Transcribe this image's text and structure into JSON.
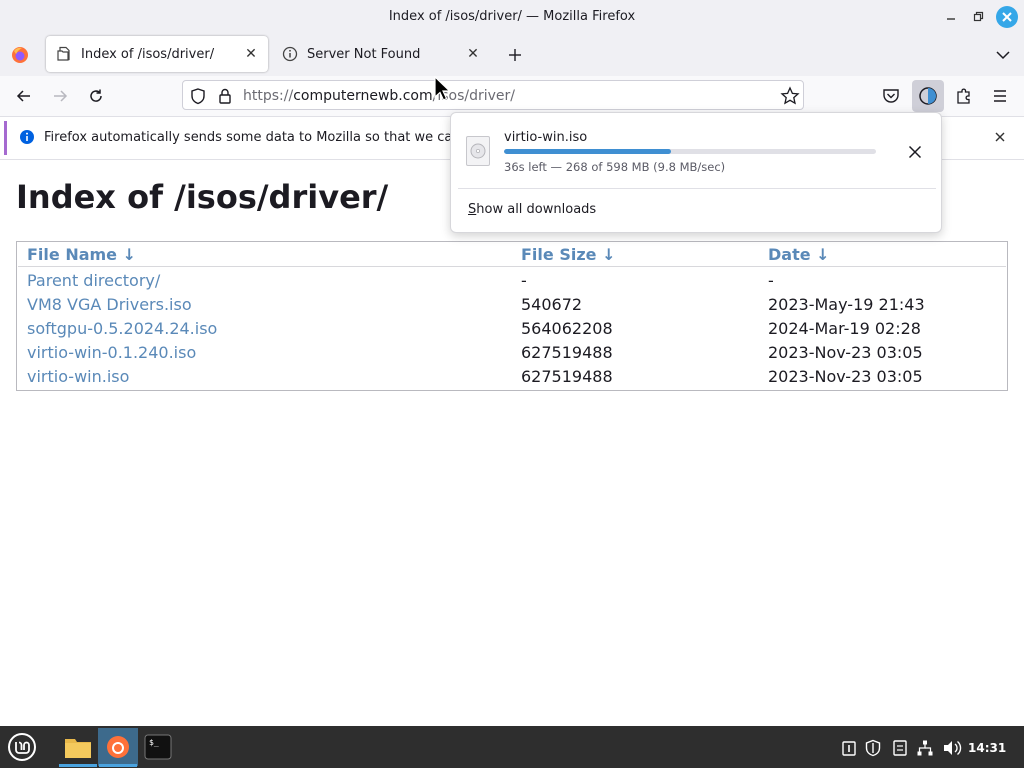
{
  "window": {
    "title": "Index of /isos/driver/ — Mozilla Firefox"
  },
  "tabs": [
    {
      "label": "Index of /isos/driver/",
      "active": true,
      "icon": "folder-page-icon"
    },
    {
      "label": "Server Not Found",
      "active": false,
      "icon": "info-icon"
    }
  ],
  "navbar": {
    "url_scheme": "https://",
    "url_host": "computernewb.com",
    "url_path": "/isos/driver/"
  },
  "notification": {
    "text": "Firefox automatically sends some data to Mozilla so that we can imp"
  },
  "page": {
    "heading": "Index of /isos/driver/",
    "columns": [
      {
        "label": "File Name  ↓"
      },
      {
        "label": "File Size  ↓"
      },
      {
        "label": "Date  ↓"
      }
    ],
    "rows": [
      {
        "name": "Parent directory/",
        "size": "-",
        "date": "-"
      },
      {
        "name": "VM8 VGA Drivers.iso",
        "size": "540672",
        "date": "2023-May-19 21:43"
      },
      {
        "name": "softgpu-0.5.2024.24.iso",
        "size": "564062208",
        "date": "2024-Mar-19 02:28"
      },
      {
        "name": "virtio-win-0.1.240.iso",
        "size": "627519488",
        "date": "2023-Nov-23 03:05"
      },
      {
        "name": "virtio-win.iso",
        "size": "627519488",
        "date": "2023-Nov-23 03:05"
      }
    ]
  },
  "downloads": {
    "filename": "virtio-win.iso",
    "progress_fraction": 0.45,
    "status": "36s left — 268 of 598 MB (9.8 MB/sec)",
    "show_all_label": "Show all downloads",
    "show_all_accesskey": "S",
    "show_all_rest": "how all downloads"
  },
  "taskbar": {
    "clock": "14:31"
  },
  "colors": {
    "link": "#5a89b8",
    "progress": "#3f8fd2",
    "info_accent": "#a56ad0",
    "close_button": "#35a7e8",
    "taskbar": "#2e2e2e"
  }
}
